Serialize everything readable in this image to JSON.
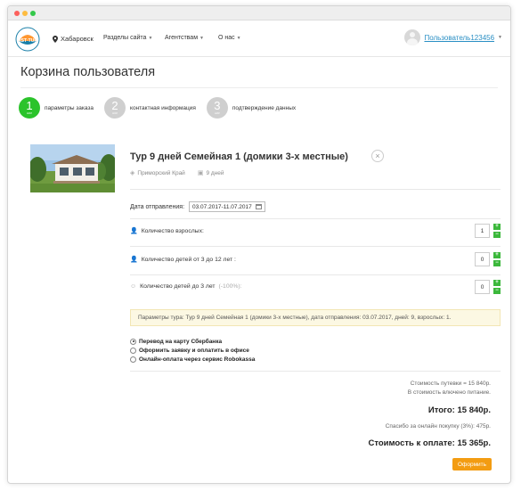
{
  "window": {
    "traffic_lights": [
      "#fc605c",
      "#fdbc40",
      "#34c84a"
    ]
  },
  "navbar": {
    "logo_text": "RST·TUR",
    "city": "Хабаровск",
    "links": [
      {
        "label": "Разделы сайта"
      },
      {
        "label": "Агентствам"
      },
      {
        "label": "О нас"
      }
    ],
    "user_name": "Пользователь123456"
  },
  "page": {
    "title": "Корзина пользователя"
  },
  "steps": [
    {
      "number": "1",
      "sub": "шаг",
      "label": "параметры заказа",
      "active": true
    },
    {
      "number": "2",
      "sub": "шаг",
      "label": "контактная информация",
      "active": false
    },
    {
      "number": "3",
      "sub": "шаг",
      "label": "подтверждение данных",
      "active": false
    }
  ],
  "tour": {
    "name": "Тур 9 дней Семейная 1 (домики 3-х местные)",
    "region": "Приморский Край",
    "duration": "9 дней",
    "close_symbol": "×"
  },
  "date": {
    "label": "Дата отправления:",
    "value": "03.07.2017-11.07.2017"
  },
  "quantities": [
    {
      "label": "Количество взрослых:",
      "note": "",
      "value": "1"
    },
    {
      "label": "Количество детей от 3 до 12 лет :",
      "note": "",
      "value": "0"
    },
    {
      "label": "Количество детей до 3 лет",
      "note": "(-100%):",
      "value": "0"
    }
  ],
  "params_text": "Параметры тура: Тур 9 дней Семейная 1 (домики 3-х местные), дата отправления: 03.07.2017, дней: 9, взрослых: 1.",
  "payments": [
    {
      "label": "Перевод на карту Сбербанка",
      "checked": true
    },
    {
      "label": "Оформить заявку и оплатить в офисе",
      "checked": false
    },
    {
      "label": "Онлайн-оплата через сервис Robokassa",
      "checked": false
    }
  ],
  "summary": {
    "cost": "Стоимость путевки = 15 840р.",
    "food": "В стоимость влючено питание.",
    "total": "Итого: 15 840р.",
    "discount": "Спасибо за онлайн покупку (3%): 475р.",
    "to_pay": "Стоимость к оплате: 15 365р."
  },
  "order_button": "Оформить",
  "colors": {
    "accent_green": "#2bc32b",
    "link_blue": "#2a8fc4",
    "order_orange": "#f39c12"
  },
  "icons": [
    "map-pin-icon",
    "chevron-down-icon",
    "avatar",
    "close-icon",
    "location-icon",
    "calendar-icon",
    "person-icon",
    "plus-icon",
    "minus-icon"
  ]
}
